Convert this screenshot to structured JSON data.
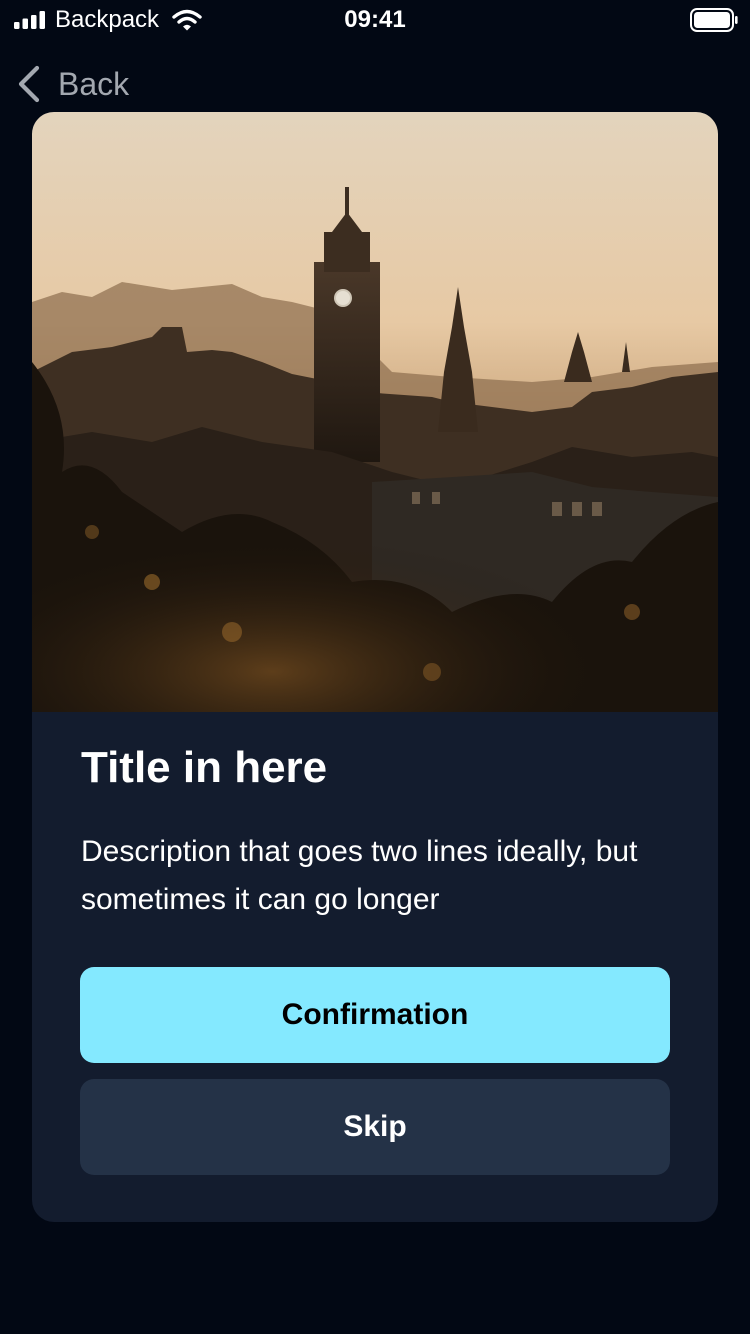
{
  "status_bar": {
    "carrier": "Backpack",
    "time": "09:41",
    "icons": [
      "signal-icon",
      "wifi-icon",
      "battery-icon"
    ]
  },
  "nav": {
    "back_label": "Back",
    "icon": "chevron-left-icon"
  },
  "card": {
    "image": "city-skyline-at-sunset",
    "title": "Title in here",
    "description": "Description that goes two lines ideally, but sometimes it can go longer",
    "buttons": {
      "confirm_label": "Confirmation",
      "skip_label": "Skip"
    }
  },
  "colors": {
    "background": "#020814",
    "card": "#131c2e",
    "primary": "#84e9ff",
    "secondary": "#243247",
    "muted_text": "#a3a8b0"
  }
}
